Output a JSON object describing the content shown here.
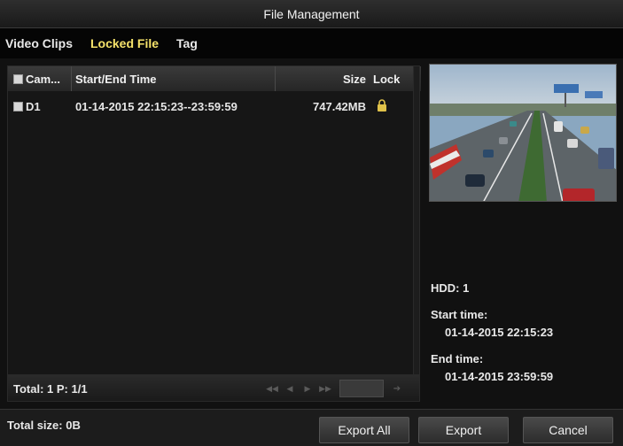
{
  "window": {
    "title": "File Management"
  },
  "tabs": [
    {
      "label": "Video Clips",
      "active": false
    },
    {
      "label": "Locked File",
      "active": true
    },
    {
      "label": "Tag",
      "active": false
    }
  ],
  "table": {
    "headers": {
      "camera": "Cam...",
      "time": "Start/End Time",
      "size": "Size",
      "lock": "Lock"
    },
    "rows": [
      {
        "camera": "D1",
        "time": "01-14-2015 22:15:23--23:59:59",
        "size": "747.42MB",
        "locked": true,
        "lock_icon": "padlock-icon"
      }
    ]
  },
  "pagination": {
    "total": "Total: 1  P: 1/1"
  },
  "details": {
    "hdd": "HDD: 1",
    "start_label": "Start time:",
    "start_value": "01-14-2015 22:15:23",
    "end_label": "End time:",
    "end_value": "01-14-2015 23:59:59"
  },
  "footer": {
    "total_size": "Total size: 0B",
    "export_all": "Export All",
    "export": "Export",
    "cancel": "Cancel"
  },
  "colors": {
    "active_tab": "#f5e26a",
    "lock_icon": "#e0c24a"
  }
}
